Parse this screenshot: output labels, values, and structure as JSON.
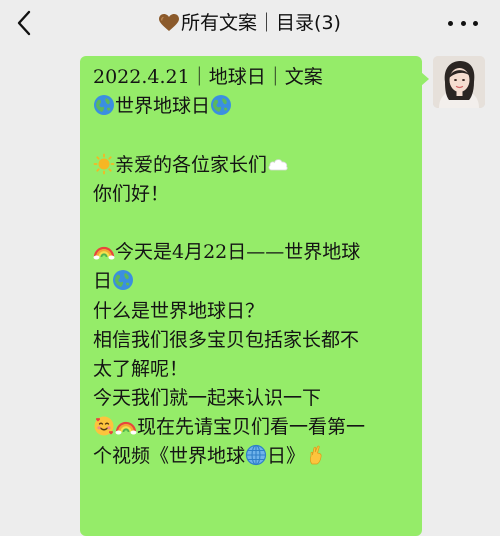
{
  "header": {
    "title": "所有文案｜目录(3)",
    "back_icon": "chevron-left-icon",
    "more_icon": "more-dots-icon",
    "title_icon": "brown-heart-icon"
  },
  "message": {
    "meta": "2022.4.21｜地球日｜文案",
    "heading": "世界地球日",
    "greeting": "亲爱的各位家长们",
    "hello": "你们好！",
    "p1": "今天是4月22日——世界地球",
    "p1b": "日",
    "q1": "什么是世界地球日？",
    "p2a": "相信我们很多宝贝包括家长都不",
    "p2b": "太了解呢！",
    "p3": "今天我们就一起来认识一下",
    "p4a": "现在先请宝贝们看一看第一",
    "p4b_pre": "个视频《世界地球",
    "p4b_post": "日》"
  },
  "colors": {
    "bubble": "#95ec69",
    "background": "#ededed",
    "text": "#141414"
  }
}
